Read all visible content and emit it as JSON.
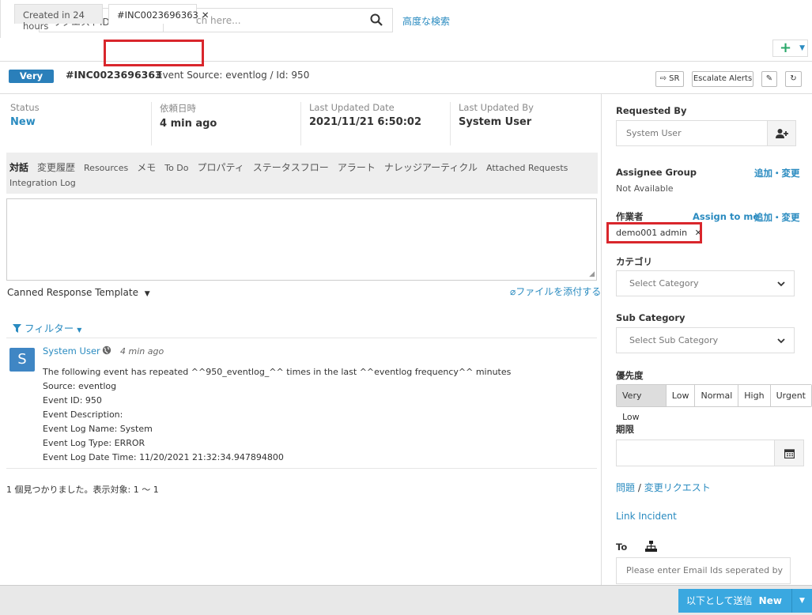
{
  "topbar": {
    "search_type": "リクエストID",
    "search_placeholder": "Search here...",
    "advanced_search": "高度な検索"
  },
  "tabs": {
    "created_label": "Created in 24 hours",
    "incident_label": "#INC0023696363",
    "close_glyph": "✕",
    "add_glyph": "+"
  },
  "header": {
    "priority_badge": "Very Low",
    "incident_id": "#INC0023696363",
    "event_source": "Event Source: eventlog / Id: 950",
    "sr_label": "SR",
    "escalate_label": "Escalate Alerts"
  },
  "info": {
    "status_label": "Status",
    "status_value": "New",
    "requested_label": "依頼日時",
    "requested_value": "4 min ago",
    "updated_label": "Last Updated Date",
    "updated_value": "2021/11/21 6:50:02",
    "updated_by_label": "Last Updated By",
    "updated_by_value": "System User"
  },
  "subtabs": [
    "対話",
    "変更履歴",
    "Resources",
    "メモ",
    "To Do",
    "プロパティ",
    "ステータスフロー",
    "アラート",
    "ナレッジアーティクル",
    "Attached Requests",
    "Integration Log"
  ],
  "reply": {
    "canned": "Canned Response Template",
    "attach": "ファイルを添付する",
    "filter": "フィルター"
  },
  "conversation": {
    "avatar": "S",
    "author": "System User",
    "time": "4 min ago",
    "lines": [
      "The following event has repeated ^^950_eventlog_^^ times in the last ^^eventlog frequency^^ minutes",
      "Source: eventlog",
      "Event ID: 950",
      "Event Description:",
      "Event Log Name: System",
      "Event Log Type: ERROR",
      "Event Log Date Time: 11/20/2021 21:32:34.947894800"
    ]
  },
  "result_count": "1 個見つかりました。表示対象: 1 ～ 1",
  "right": {
    "requested_by_label": "Requested By",
    "requested_by_value": "System User",
    "assignee_group_label": "Assignee Group",
    "assignee_group_link": "追加・変更",
    "assignee_group_value": "Not Available",
    "worker_label": "作業者",
    "assign_to_me": "Assign to me",
    "worker_link": "追加・変更",
    "worker_chip": "demo001 admin",
    "category_label": "カテゴリ",
    "category_placeholder": "Select Category",
    "subcategory_label": "Sub Category",
    "subcategory_placeholder": "Select Sub Category",
    "priority_label": "優先度",
    "priority_options": [
      "Very Low",
      "Low",
      "Normal",
      "High",
      "Urgent"
    ],
    "priority_selected": "Very Low",
    "due_label": "期限",
    "problem_link": "問題",
    "change_link": "変更リクエスト",
    "link_incident": "Link Incident",
    "to_label": "To",
    "email_placeholder": "Please enter Email Ids seperated by (,)"
  },
  "footer": {
    "send_label": "以下として送信",
    "send_status": "New"
  },
  "colors": {
    "accent": "#2a8bc0",
    "badge": "#2a7fba",
    "highlight_box": "#d9262c",
    "send_button": "#3aa8e0"
  }
}
